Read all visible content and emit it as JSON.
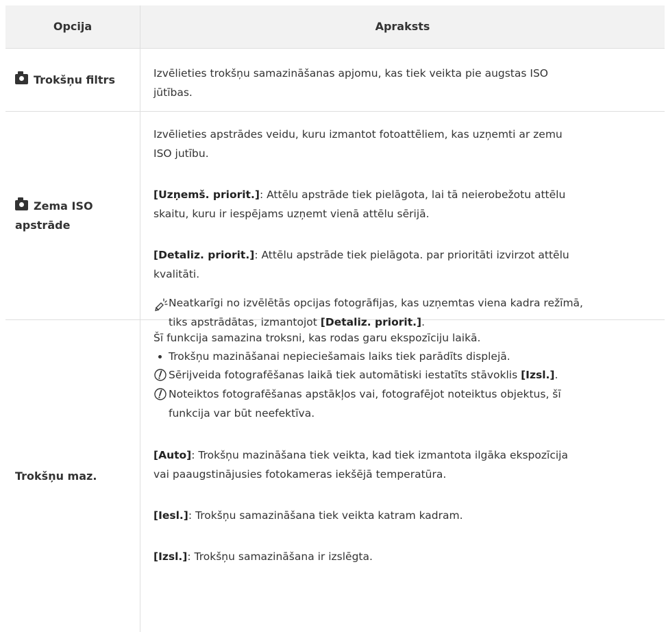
{
  "table": {
    "headers": {
      "option": "Opcija",
      "description": "Apraksts"
    },
    "rows": [
      {
        "option": "Trokšņu filtrs",
        "icon": "camera-icon",
        "description": [
          "Izvēlieties trokšņu samazināšanas apjomu, kas tiek veikta pie augstas ISO",
          "jūtības."
        ]
      },
      {
        "option_line1": "Zema ISO",
        "option_line2": "apstrāde",
        "icon": "camera-icon",
        "intro": [
          "Izvēlieties apstrādes veidu, kuru izmantot fotoattēliem, kas uzņemti ar zemu",
          "ISO jutību."
        ],
        "items": [
          {
            "label": "[Uzņemš. priorit.]",
            "text_line1": ": Attēlu apstrāde tiek pielāgota, lai tā neierobežotu attēlu",
            "text_line2": "skaitu, kuru ir iespējams uzņemt vienā attēlu sērijā."
          },
          {
            "label": "[Detaliz. priorit.]",
            "text_line1": ": Attēlu apstrāde tiek pielāgota. par prioritāti izvirzot attēlu",
            "text_line2": "kvalitāti."
          }
        ],
        "tip": {
          "icon": "tip-pencil-icon",
          "line1": "Neatkarīgi no izvēlētās opcijas fotogrāfijas, kas uzņemtas viena kadra režīmā,",
          "line2_pre": "tiks apstrādātas, izmantojot ",
          "line2_bold": "[Detaliz. priorit.]",
          "line2_post": "."
        }
      },
      {
        "option": "Trokšņu maz.",
        "intro": "Šī funkcija samazina troksni, kas rodas garu ekspozīciju laikā.",
        "bullet": "Trokšņu mazināšanai nepieciešamais laiks tiek parādīts displejā.",
        "caution1": {
          "icon": "caution-icon",
          "pre": "Sērijveida fotografēšanas laikā tiek automātiski iestatīts stāvoklis ",
          "bold": "[Izsl.]",
          "post": "."
        },
        "caution2": {
          "icon": "caution-icon",
          "line1": "Noteiktos fotografēšanas apstākļos vai, fotografējot noteiktus objektus, šī",
          "line2": "funkcija var būt neefektīva."
        },
        "items": [
          {
            "label": "[Auto]",
            "text_line1": ": Trokšņu mazināšana tiek veikta, kad tiek izmantota ilgāka ekspozīcija",
            "text_line2": "vai paaugstinājusies fotokameras iekšējā temperatūra."
          },
          {
            "label": "[Iesl.]",
            "text_line1": ": Trokšņu samazināšana tiek veikta katram kadram."
          },
          {
            "label": "[Izsl.]",
            "text_line1": ": Trokšņu samazināšana ir izslēgta."
          }
        ]
      }
    ]
  }
}
